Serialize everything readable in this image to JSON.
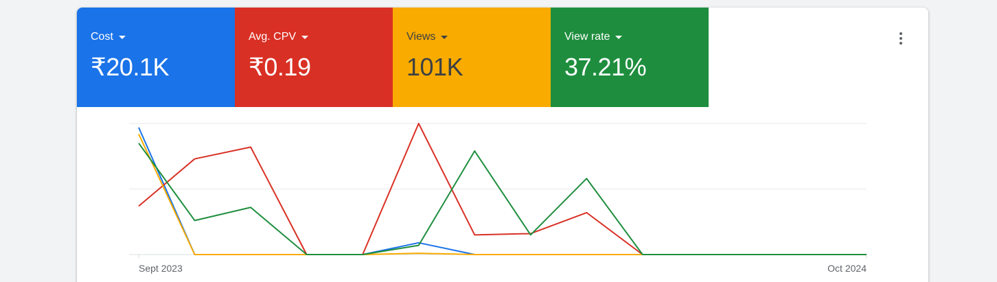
{
  "metrics": [
    {
      "label": "Cost",
      "value": "₹20.1K",
      "bg": "#1a73e8",
      "fg": "#ffffff"
    },
    {
      "label": "Avg. CPV",
      "value": "₹0.19",
      "bg": "#d93025",
      "fg": "#ffffff"
    },
    {
      "label": "Views",
      "value": "101K",
      "bg": "#f9ab00",
      "fg": "#3c4043"
    },
    {
      "label": "View rate",
      "value": "37.21%",
      "bg": "#1e8e3e",
      "fg": "#ffffff"
    }
  ],
  "menu_icon": "more-vert-icon",
  "chart_data": {
    "type": "line",
    "x_tick_labels": [
      "Sept 2023",
      "Oct 2024"
    ],
    "x_points": 14,
    "y_range": [
      0,
      1
    ],
    "grid": true,
    "series": [
      {
        "name": "Cost",
        "color": "#1a73e8",
        "values": [
          0.97,
          0.0,
          0.0,
          0.0,
          0.0,
          0.09,
          0.0,
          0.0,
          0.0,
          0.0,
          0.0,
          0.0,
          0.0,
          0.0
        ]
      },
      {
        "name": "Avg. CPV",
        "color": "#d93025",
        "values": [
          0.37,
          0.73,
          0.82,
          0.0,
          0.0,
          1.0,
          0.15,
          0.16,
          0.32,
          0.0,
          0.0,
          0.0,
          0.0,
          0.0
        ]
      },
      {
        "name": "Views",
        "color": "#f9ab00",
        "values": [
          0.92,
          0.0,
          0.0,
          0.0,
          0.0,
          0.01,
          0.0,
          0.0,
          0.0,
          0.0,
          0.0,
          0.0,
          0.0,
          0.0
        ]
      },
      {
        "name": "View rate",
        "color": "#1e8e3e",
        "values": [
          0.85,
          0.26,
          0.36,
          0.0,
          0.0,
          0.07,
          0.79,
          0.15,
          0.58,
          0.0,
          0.0,
          0.0,
          0.0,
          0.0
        ]
      }
    ]
  }
}
